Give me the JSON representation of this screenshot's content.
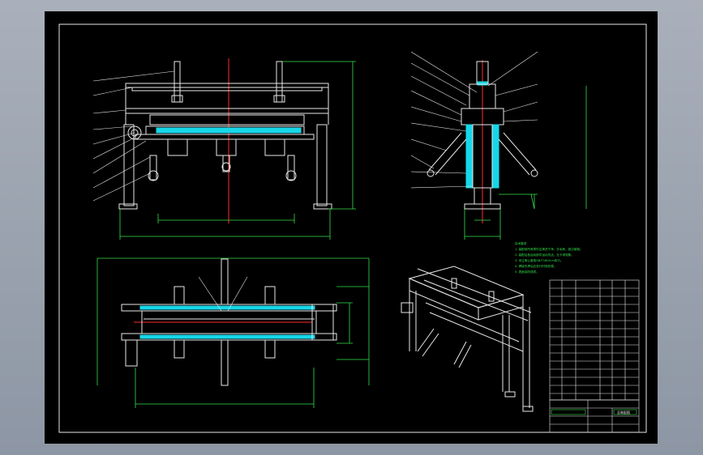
{
  "drawing": {
    "frame_color": "#ffffff",
    "background": "#000000",
    "dimension_color": "#35e04a",
    "centerline_color": "#ff2a2a",
    "section_color": "#16d7e8",
    "notes_title": "技术要求",
    "notes": [
      "1. 装配前所有零件应清洗干净，去毛刺，锐边倒钝。",
      "2. 装配后各运动部件运动灵活，无卡滞现象。",
      "3. 未注明公差按GB/T1804-m执行。",
      "4. 焊接件焊后应进行时效处理。",
      "5. 表面涂防锈漆。"
    ],
    "title_block": {
      "name": "总装配图"
    }
  }
}
